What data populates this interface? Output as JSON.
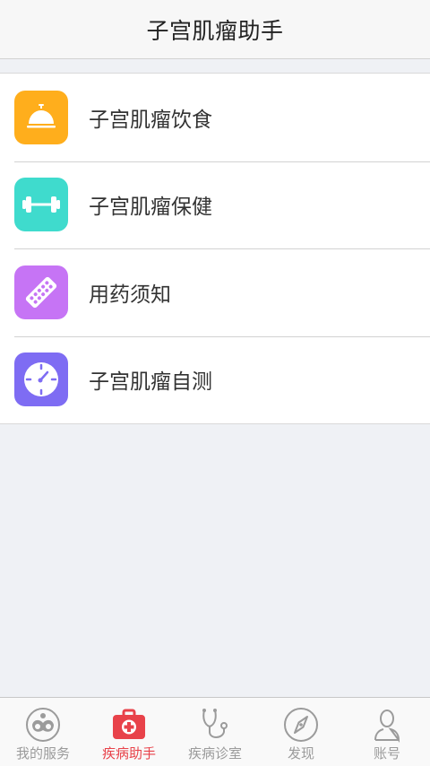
{
  "header": {
    "title": "子宫肌瘤助手"
  },
  "menu": {
    "items": [
      {
        "label": "子宫肌瘤饮食",
        "icon": "service-bell-icon",
        "color": "#ffae1c"
      },
      {
        "label": "子宫肌瘤保健",
        "icon": "dumbbell-icon",
        "color": "#3fdbcd"
      },
      {
        "label": "用药须知",
        "icon": "pill-icon",
        "color": "#c674f5"
      },
      {
        "label": "子宫肌瘤自测",
        "icon": "gauge-icon",
        "color": "#7e6cf3"
      }
    ]
  },
  "tabbar": {
    "active_color": "#e8424a",
    "inactive_color": "#9b9b9b",
    "items": [
      {
        "label": "我的服务",
        "icon": "family-icon"
      },
      {
        "label": "疾病助手",
        "icon": "medical-kit-icon",
        "active": true
      },
      {
        "label": "疾病诊室",
        "icon": "stethoscope-icon"
      },
      {
        "label": "发现",
        "icon": "compass-icon"
      },
      {
        "label": "账号",
        "icon": "user-icon"
      }
    ]
  }
}
